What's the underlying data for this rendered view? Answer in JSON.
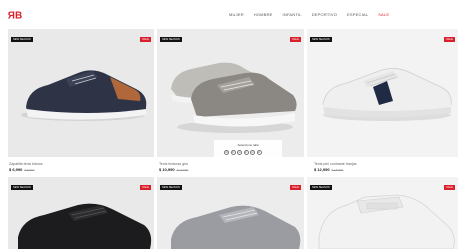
{
  "nav": {
    "items": [
      "Mujer",
      "Hombre",
      "Infantil",
      "Deportivo",
      "Especial",
      "Sale"
    ]
  },
  "colors": {
    "brand": "#d9202c",
    "badge_dark": "#111111"
  },
  "badges": {
    "new": "NEW SEASON",
    "sale": "SALE"
  },
  "products": [
    {
      "name": "Zapatilla tenis básica",
      "price": "$ 6,990",
      "old_price": "$ 8,990"
    },
    {
      "name": "Tenis texturas gris",
      "price": "$ 10,990",
      "old_price": "$ 13,990"
    },
    {
      "name": "Tenis piel contraste franjas",
      "price": "$ 12,990",
      "old_price": "$ 15,990"
    }
  ],
  "size_picker": {
    "title": "Seleccione talla",
    "sizes": [
      "38",
      "39",
      "40",
      "41",
      "42",
      "43"
    ]
  }
}
